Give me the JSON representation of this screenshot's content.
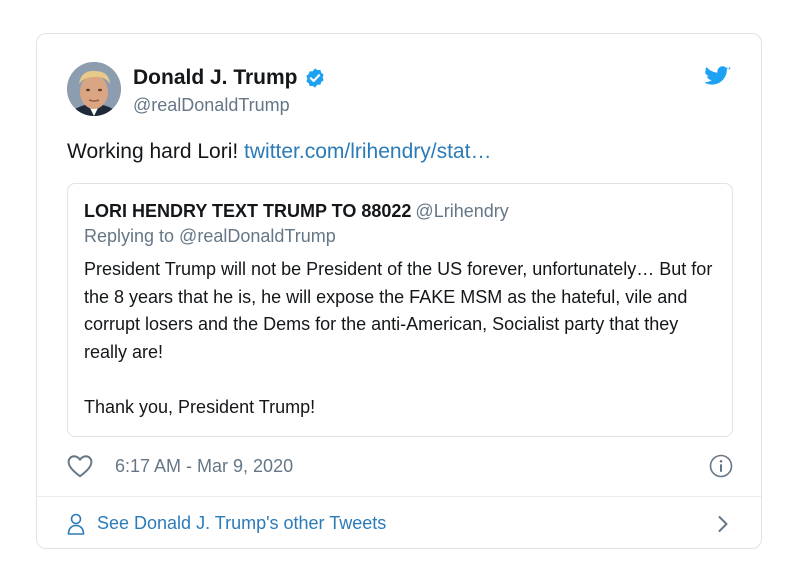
{
  "colors": {
    "link": "#2b7bb9",
    "twitter_blue": "#1da1f2",
    "text_primary": "#14171a",
    "text_secondary": "#657786",
    "border": "#dfe3e7"
  },
  "tweet": {
    "author": {
      "name": "Donald J. Trump",
      "handle": "@realDonaldTrump",
      "verified_icon": "verified-badge-icon",
      "avatar_icon": "avatar"
    },
    "brand_icon": "twitter-bird-icon",
    "text": "Working hard Lori! ",
    "link_text": "twitter.com/lrihendry/stat…",
    "quoted": {
      "name": "LORI HENDRY TEXT TRUMP TO 88022",
      "handle": "@Lrihendry",
      "replying_to": "Replying to @realDonaldTrump",
      "paragraphs": [
        "President Trump will not be President of the US forever, unfortunately… But for the 8 years that he is, he will expose the FAKE MSM as the hateful, vile and corrupt losers and the Dems for the anti-American, Socialist party that they really are!",
        "Thank you, President Trump!"
      ]
    },
    "timestamp": "6:17 AM - Mar 9, 2020",
    "like_icon": "heart-icon",
    "info_icon": "info-icon"
  },
  "footer": {
    "link_text": "See Donald J. Trump's other Tweets",
    "person_icon": "person-icon",
    "chevron_icon": "chevron-right-icon"
  }
}
